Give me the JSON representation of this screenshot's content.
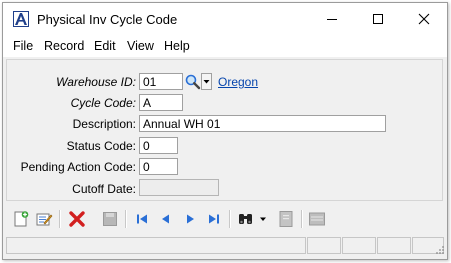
{
  "window": {
    "title": "Physical Inv Cycle Code"
  },
  "menu": {
    "items": [
      {
        "label": "File"
      },
      {
        "label": "Record"
      },
      {
        "label": "Edit"
      },
      {
        "label": "View"
      },
      {
        "label": "Help"
      }
    ]
  },
  "form": {
    "warehouse_id": {
      "label": "Warehouse ID:",
      "value": "01",
      "link_text": "Oregon"
    },
    "cycle_code": {
      "label": "Cycle Code:",
      "value": "A"
    },
    "description": {
      "label": "Description:",
      "value": "Annual WH 01"
    },
    "status_code": {
      "label": "Status Code:",
      "value": "0"
    },
    "pending_action_code": {
      "label": "Pending Action Code:",
      "value": "0"
    },
    "cutoff_date": {
      "label": "Cutoff Date:",
      "value": ""
    }
  },
  "toolbar": {
    "icons": [
      "new-record-icon",
      "edit-record-icon",
      "delete-icon",
      "save-icon",
      "first-record-icon",
      "previous-record-icon",
      "next-record-icon",
      "last-record-icon",
      "binoculars-find-icon",
      "notes-icon",
      "list-icon"
    ]
  },
  "colors": {
    "link": "#0645ad",
    "delete_red": "#d21f1f",
    "nav_blue": "#2a6fd6",
    "app_icon_blue": "#1f3f8a"
  }
}
